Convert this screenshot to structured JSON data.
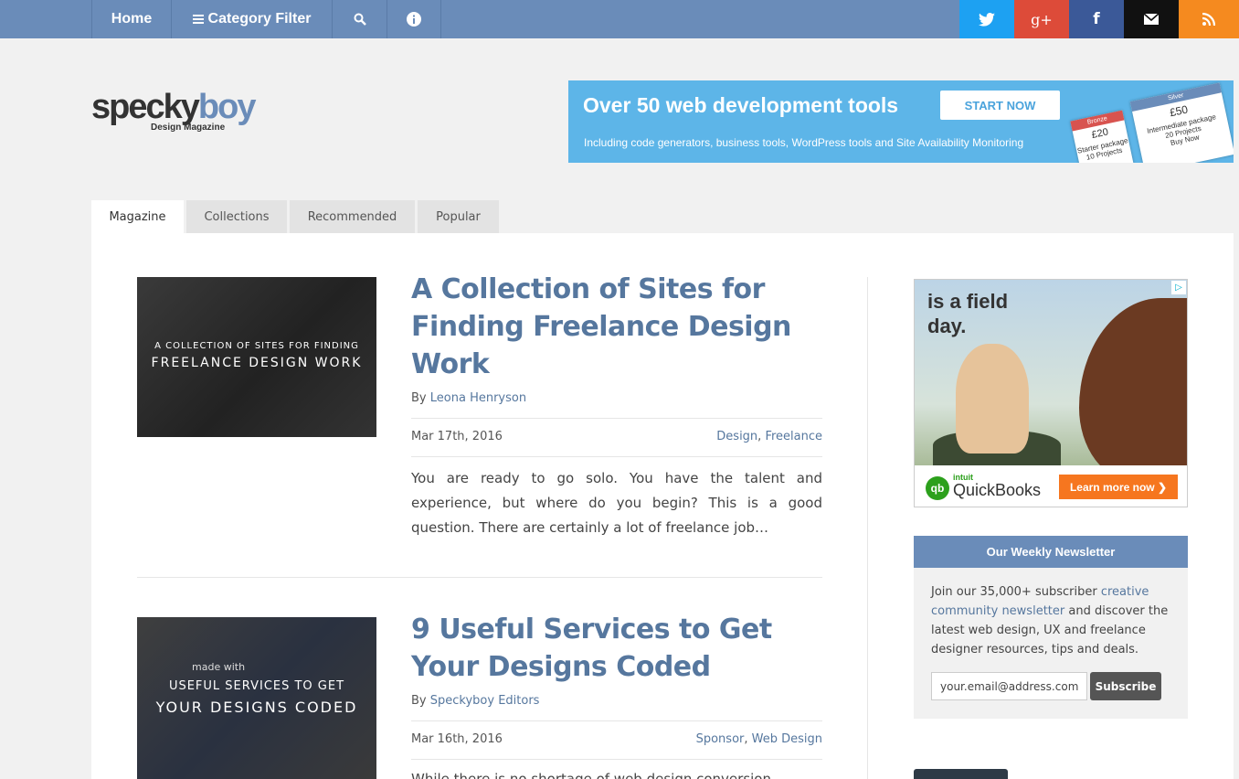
{
  "nav": {
    "home": "Home",
    "category_filter": "Category Filter",
    "search_icon": "search-icon",
    "info_icon": "info-icon"
  },
  "social": {
    "twitter": "twitter-icon",
    "googleplus": "googleplus-icon",
    "facebook": "facebook-icon",
    "email": "email-icon",
    "rss": "rss-icon"
  },
  "logo": {
    "word_a": "specky",
    "word_b": "boy",
    "subtitle": "Design Magazine"
  },
  "banner_ad": {
    "headline": "Over 50 web development tools",
    "button": "START NOW",
    "subtext": "Including code generators, business tools, WordPress tools and Site Availability Monitoring",
    "card1_title": "Bronze",
    "card1_price": "£20",
    "card1_line1": "Starter package",
    "card1_line2": "10 Projects",
    "card2_title": "Silver",
    "card2_price": "£50",
    "card2_line1": "Intermediate package",
    "card2_line2": "20 Projects",
    "card2_line3": "Buy Now"
  },
  "tabs": [
    "Magazine",
    "Collections",
    "Recommended",
    "Popular"
  ],
  "posts": [
    {
      "thumb_small": "A COLLECTION OF SITES FOR FINDING",
      "thumb_big": "FREELANCE DESIGN WORK",
      "title": "A Collection of Sites for Finding Freelance Design Work",
      "by": "By",
      "author": "Leona Henryson",
      "date": "Mar 17th, 2016",
      "cat1": "Design",
      "cat2": "Freelance",
      "excerpt": "You are ready to go solo. You have the talent and experience, but where do you begin? This is a good question. There are certainly a lot of freelance job…"
    },
    {
      "thumb_made": "made with",
      "thumb_small": "USEFUL SERVICES TO GET",
      "thumb_big": "YOUR DESIGNS CODED",
      "title": "9 Useful Services to Get Your Designs Coded",
      "by": "By",
      "author": "Speckyboy Editors",
      "date": "Mar 16th, 2016",
      "cat1": "Sponsor",
      "cat2": "Web Design",
      "excerpt": "While there is no shortage of web design conversion"
    }
  ],
  "side_ad": {
    "headline_1": "is a field",
    "headline_2": "day.",
    "brand_small": "intuit",
    "brand": "QuickBooks",
    "button": "Learn more now ❯"
  },
  "newsletter": {
    "title": "Our Weekly Newsletter",
    "text_a": "Join our 35,000+ subscriber",
    "link": "creative community newsletter",
    "text_b": "and discover the latest web design, UX and freelance designer resources, tips and deals.",
    "input_value": "your.email@address.com",
    "button": "Subscribe"
  },
  "colors": {
    "nav": "#6a8cb9",
    "accent_text": "#56779e",
    "twitter": "#1da1f2",
    "googleplus": "#dd4b39",
    "facebook": "#3b5998",
    "email": "#111111",
    "rss": "#f58a1f"
  }
}
